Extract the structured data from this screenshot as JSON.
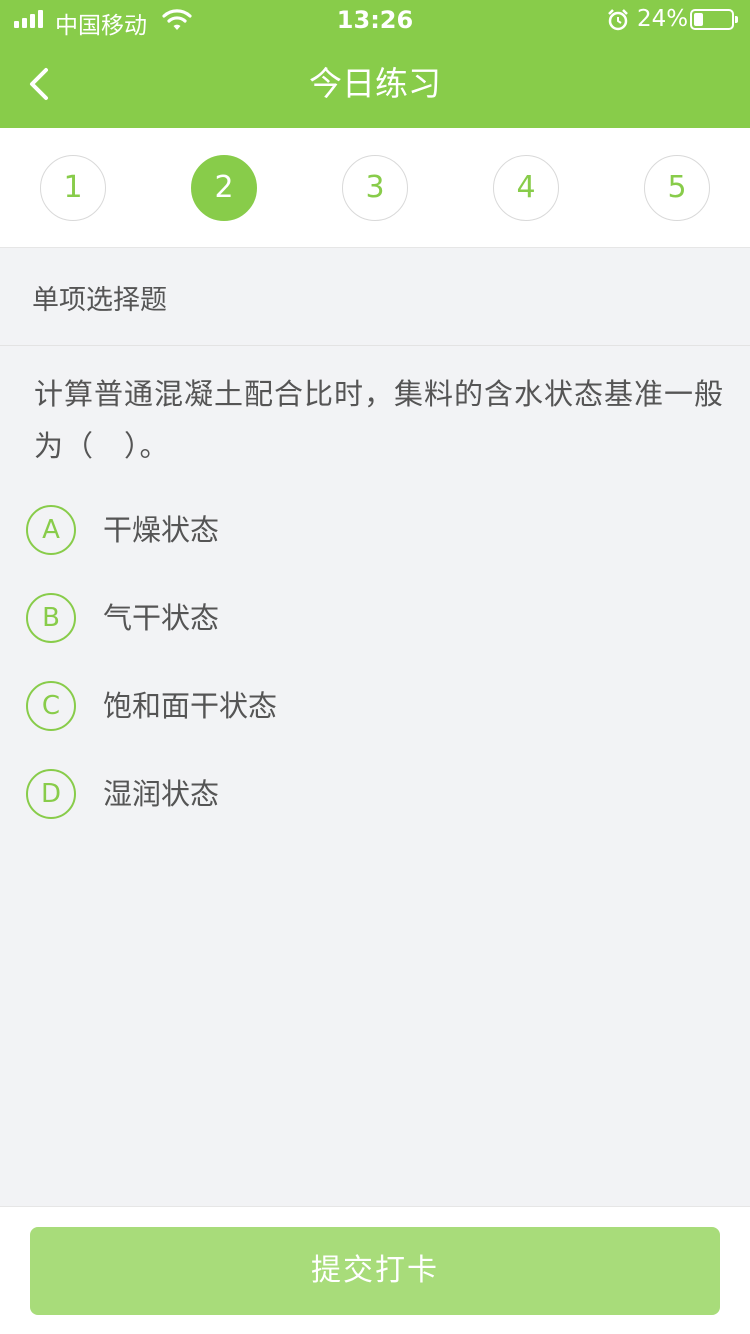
{
  "status_bar": {
    "carrier": "中国移动",
    "time": "13:26",
    "battery": "24%",
    "icons": [
      "signal-icon",
      "wifi-icon",
      "alarm-icon",
      "battery-icon"
    ]
  },
  "header": {
    "title": "今日练习",
    "back_icon": "chevron-left-icon",
    "color": "#88cc4a"
  },
  "steps": {
    "items": [
      "1",
      "2",
      "3",
      "4",
      "5"
    ],
    "active_index": 1
  },
  "question": {
    "type": "单项选择题",
    "text": "计算普通混凝土配合比时，集料的含水状态基准一般为（　）。",
    "options": [
      {
        "letter": "A",
        "text": "干燥状态"
      },
      {
        "letter": "B",
        "text": "气干状态"
      },
      {
        "letter": "C",
        "text": "饱和面干状态"
      },
      {
        "letter": "D",
        "text": "湿润状态"
      }
    ]
  },
  "submit": {
    "label": "提交打卡"
  }
}
